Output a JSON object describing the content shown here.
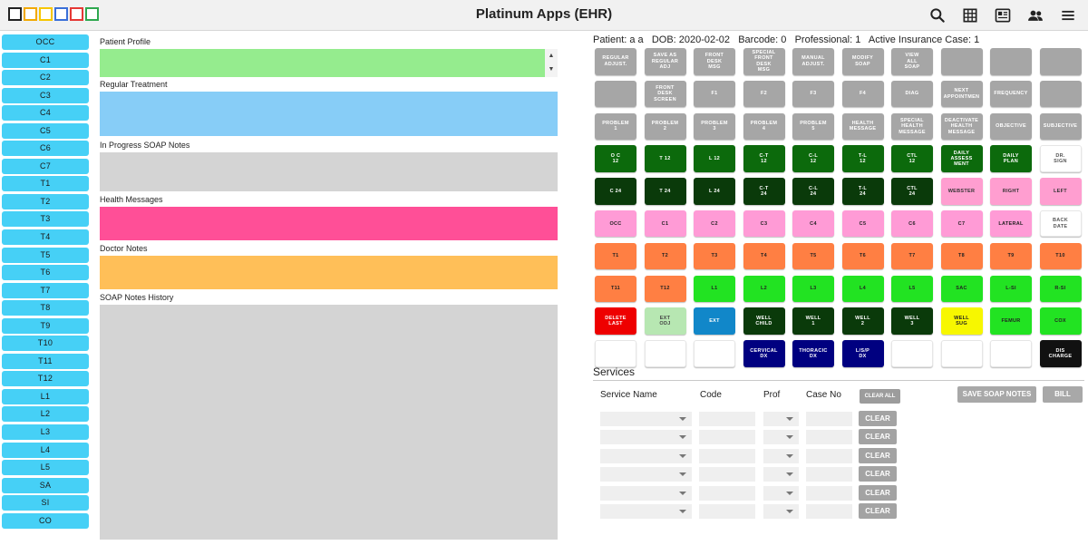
{
  "header": {
    "title": "Platinum Apps (EHR)",
    "logo_colors": [
      "#222222",
      "#f2a900",
      "#f7c600",
      "#3b6fd8",
      "#e53935",
      "#2fa84f"
    ],
    "icons": [
      "search-icon",
      "grid-icon",
      "newspaper-icon",
      "people-icon",
      "menu-icon"
    ]
  },
  "left_buttons": [
    "OCC",
    "C1",
    "C2",
    "C3",
    "C4",
    "C5",
    "C6",
    "C7",
    "T1",
    "T2",
    "T3",
    "T4",
    "T5",
    "T6",
    "T7",
    "T8",
    "T9",
    "T10",
    "T11",
    "T12",
    "L1",
    "L2",
    "L3",
    "L4",
    "L5",
    "SA",
    "SI",
    "CO"
  ],
  "sections": {
    "patient_profile": "Patient Profile",
    "regular_treatment": "Regular Treatment",
    "in_progress_soap": "In Progress SOAP Notes",
    "health_messages": "Health Messages",
    "doctor_notes": "Doctor Notes",
    "soap_history": "SOAP Notes History"
  },
  "patient_info": "Patient: a a   DOB: 2020-02-02   Barcode: 0   Professional: 1   Active Insurance Case: 1",
  "grid_buttons": [
    {
      "label": "REGULAR\nADJUST.",
      "color": "gray"
    },
    {
      "label": "SAVE AS\nREGULAR\nADJ",
      "color": "gray"
    },
    {
      "label": "FRONT\nDESK\nMSG",
      "color": "gray"
    },
    {
      "label": "SPECIAL\nFRONT\nDESK\nMSG",
      "color": "gray"
    },
    {
      "label": "MANUAL\nADJUST.",
      "color": "gray"
    },
    {
      "label": "MODIFY\nSOAP",
      "color": "gray"
    },
    {
      "label": "VIEW\nALL\nSOAP",
      "color": "gray"
    },
    {
      "label": "",
      "color": "gray"
    },
    {
      "label": "",
      "color": "gray"
    },
    {
      "label": "",
      "color": "gray"
    },
    {
      "label": "",
      "color": "gray"
    },
    {
      "label": "FRONT\nDESK\nSCREEN",
      "color": "gray"
    },
    {
      "label": "F1",
      "color": "gray"
    },
    {
      "label": "F2",
      "color": "gray"
    },
    {
      "label": "F3",
      "color": "gray"
    },
    {
      "label": "F4",
      "color": "gray"
    },
    {
      "label": "DIAG",
      "color": "gray"
    },
    {
      "label": "NEXT\nAPPOINTMEN",
      "color": "gray"
    },
    {
      "label": "FREQUENCY",
      "color": "gray"
    },
    {
      "label": "",
      "color": "gray"
    },
    {
      "label": "PROBLEM\n1",
      "color": "gray"
    },
    {
      "label": "PROBLEM\n2",
      "color": "gray"
    },
    {
      "label": "PROBLEM\n3",
      "color": "gray"
    },
    {
      "label": "PROBLEM\n4",
      "color": "gray"
    },
    {
      "label": "PROBLEM\n5",
      "color": "gray"
    },
    {
      "label": "HEALTH\nMESSAGE",
      "color": "gray"
    },
    {
      "label": "SPECIAL\nHEALTH\nMESSAGE",
      "color": "gray"
    },
    {
      "label": "DEACTIVATE\nHEALTH\nMESSAGE",
      "color": "gray"
    },
    {
      "label": "OBJECTIVE",
      "color": "gray"
    },
    {
      "label": "SUBJECTIVE",
      "color": "gray"
    },
    {
      "label": "O C\n12",
      "color": "dkgreen"
    },
    {
      "label": "T 12",
      "color": "dkgreen"
    },
    {
      "label": "L 12",
      "color": "dkgreen"
    },
    {
      "label": "C-T\n12",
      "color": "dkgreen"
    },
    {
      "label": "C-L\n12",
      "color": "dkgreen"
    },
    {
      "label": "T-L\n12",
      "color": "dkgreen"
    },
    {
      "label": "CTL\n12",
      "color": "dkgreen"
    },
    {
      "label": "DAILY\nASSESS\nMENT",
      "color": "dkgreen"
    },
    {
      "label": "DAILY\nPLAN",
      "color": "dkgreen"
    },
    {
      "label": "DR.\nSIGN",
      "color": "white"
    },
    {
      "label": "C 24",
      "color": "xdkgreen"
    },
    {
      "label": "T 24",
      "color": "xdkgreen"
    },
    {
      "label": "L 24",
      "color": "xdkgreen"
    },
    {
      "label": "C-T\n24",
      "color": "xdkgreen"
    },
    {
      "label": "C-L\n24",
      "color": "xdkgreen"
    },
    {
      "label": "T-L\n24",
      "color": "xdkgreen"
    },
    {
      "label": "CTL\n24",
      "color": "xdkgreen"
    },
    {
      "label": "WEBSTER",
      "color": "lpink"
    },
    {
      "label": "RIGHT",
      "color": "lpink"
    },
    {
      "label": "LEFT",
      "color": "lpink"
    },
    {
      "label": "OCC",
      "color": "pink"
    },
    {
      "label": "C1",
      "color": "pink"
    },
    {
      "label": "C2",
      "color": "pink"
    },
    {
      "label": "C3",
      "color": "pink"
    },
    {
      "label": "C4",
      "color": "pink"
    },
    {
      "label": "C5",
      "color": "pink"
    },
    {
      "label": "C6",
      "color": "pink"
    },
    {
      "label": "C7",
      "color": "pink"
    },
    {
      "label": "LATERAL",
      "color": "pink"
    },
    {
      "label": "BACK\nDATE",
      "color": "white"
    },
    {
      "label": "T1",
      "color": "orange"
    },
    {
      "label": "T2",
      "color": "orange"
    },
    {
      "label": "T3",
      "color": "orange"
    },
    {
      "label": "T4",
      "color": "orange"
    },
    {
      "label": "T5",
      "color": "orange"
    },
    {
      "label": "T6",
      "color": "orange"
    },
    {
      "label": "T7",
      "color": "orange"
    },
    {
      "label": "T8",
      "color": "orange"
    },
    {
      "label": "T9",
      "color": "orange"
    },
    {
      "label": "T10",
      "color": "orange"
    },
    {
      "label": "T11",
      "color": "orange"
    },
    {
      "label": "T12",
      "color": "orange"
    },
    {
      "label": "L1",
      "color": "lime"
    },
    {
      "label": "L2",
      "color": "lime"
    },
    {
      "label": "L3",
      "color": "lime"
    },
    {
      "label": "L4",
      "color": "lime"
    },
    {
      "label": "L5",
      "color": "lime"
    },
    {
      "label": "SAC",
      "color": "lime"
    },
    {
      "label": "L-SI",
      "color": "lime"
    },
    {
      "label": "R-SI",
      "color": "lime"
    },
    {
      "label": "DELETE\nLAST",
      "color": "red"
    },
    {
      "label": "EXT\nODJ",
      "color": "mint"
    },
    {
      "label": "EXT",
      "color": "blue"
    },
    {
      "label": "WELL\nCHILD",
      "color": "xdkgreen"
    },
    {
      "label": "WELL\n1",
      "color": "xdkgreen"
    },
    {
      "label": "WELL\n2",
      "color": "xdkgreen"
    },
    {
      "label": "WELL\n3",
      "color": "xdkgreen"
    },
    {
      "label": "WELL\nSUG",
      "color": "yellow"
    },
    {
      "label": "FEMUR",
      "color": "lime"
    },
    {
      "label": "COX",
      "color": "lime"
    },
    {
      "label": "",
      "color": "white"
    },
    {
      "label": "",
      "color": "white"
    },
    {
      "label": "",
      "color": "white"
    },
    {
      "label": "CERVICAL\nDX",
      "color": "navy"
    },
    {
      "label": "THORACIC\nDX",
      "color": "navy"
    },
    {
      "label": "L/S/P\nDX",
      "color": "navy"
    },
    {
      "label": "",
      "color": "white"
    },
    {
      "label": "",
      "color": "white"
    },
    {
      "label": "",
      "color": "white"
    },
    {
      "label": "DIS\nCHARGE",
      "color": "black"
    }
  ],
  "services": {
    "title": "Services",
    "columns": {
      "service_name": "Service Name",
      "code": "Code",
      "prof": "Prof",
      "case_no": "Case No"
    },
    "clear_all_label": "CLEAR ALL",
    "save_label": "SAVE SOAP NOTES",
    "bill_label": "BILL",
    "clear_label": "CLEAR",
    "row_count": 6
  }
}
